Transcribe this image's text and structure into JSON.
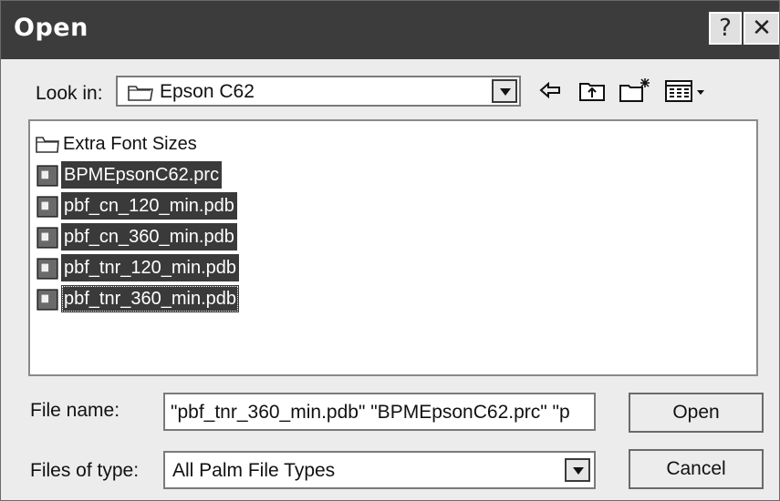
{
  "window": {
    "title": "Open",
    "help_glyph": "?",
    "close_glyph": "✕"
  },
  "look_in": {
    "label": "Look in:",
    "value": "Epson C62",
    "icon": "folder-icon"
  },
  "toolbar": [
    {
      "name": "back-icon"
    },
    {
      "name": "up-one-level-icon"
    },
    {
      "name": "create-new-folder-icon"
    },
    {
      "name": "view-menu-icon"
    }
  ],
  "files": [
    {
      "name": "Extra Font Sizes",
      "type": "folder",
      "selected": false
    },
    {
      "name": "BPMEpsonC62.prc",
      "type": "file",
      "selected": true
    },
    {
      "name": "pbf_cn_120_min.pdb",
      "type": "file",
      "selected": true
    },
    {
      "name": "pbf_cn_360_min.pdb",
      "type": "file",
      "selected": true
    },
    {
      "name": "pbf_tnr_120_min.pdb",
      "type": "file",
      "selected": true
    },
    {
      "name": "pbf_tnr_360_min.pdb",
      "type": "file",
      "selected": true
    }
  ],
  "file_name": {
    "label": "File name:",
    "value": "\"pbf_tnr_360_min.pdb\" \"BPMEpsonC62.prc\" \"p"
  },
  "file_type": {
    "label": "Files of type:",
    "value": "All Palm File Types"
  },
  "buttons": {
    "open": "Open",
    "cancel": "Cancel"
  }
}
